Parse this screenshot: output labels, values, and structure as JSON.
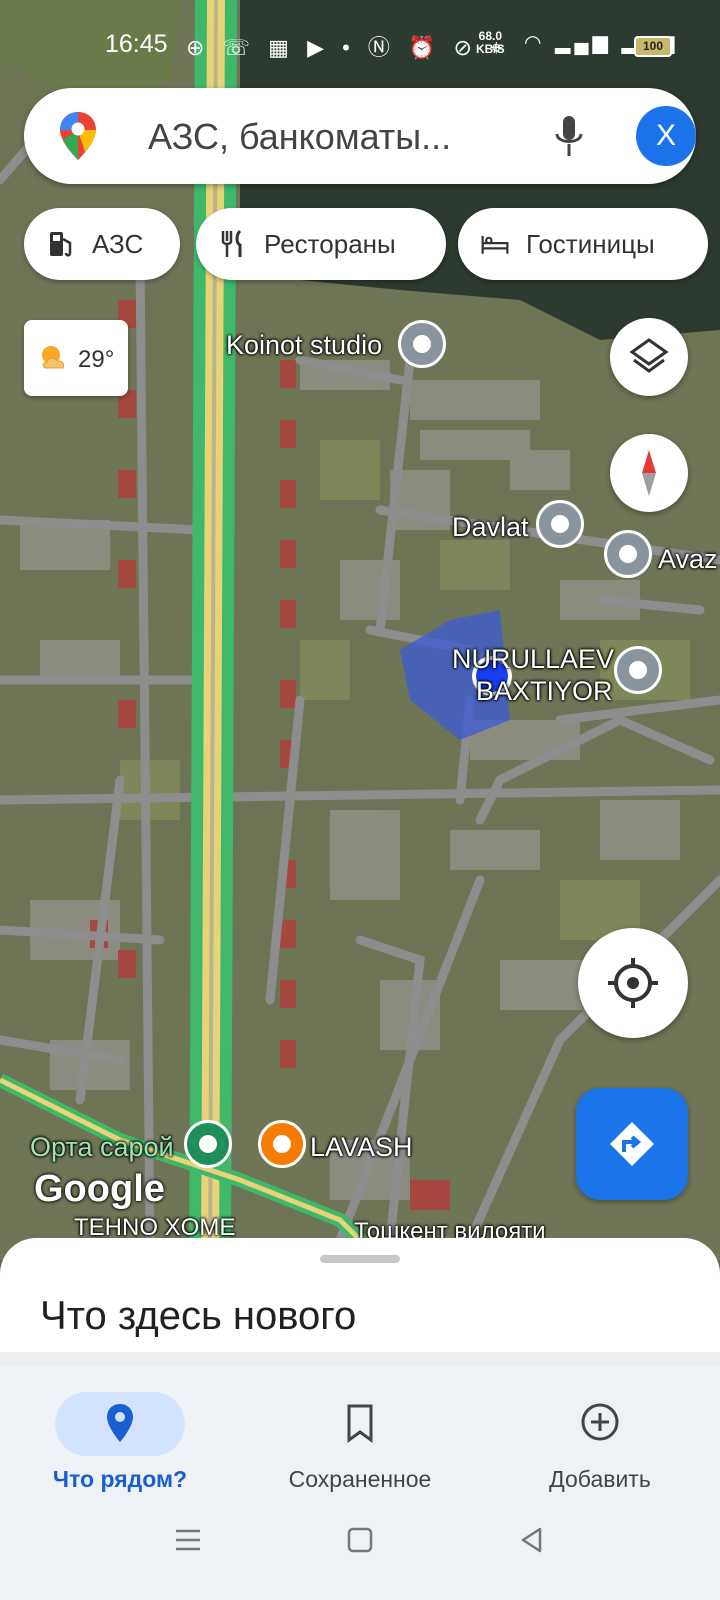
{
  "status_bar": {
    "time": "16:45",
    "speed_value": "68.0",
    "speed_unit": "KB/S",
    "battery": "100"
  },
  "search": {
    "placeholder": "АЗС, банкоматы...",
    "avatar_letter": "X"
  },
  "chips": [
    {
      "label": "АЗС",
      "icon": "gas-station-icon"
    },
    {
      "label": "Рестораны",
      "icon": "restaurant-icon"
    },
    {
      "label": "Гостиницы",
      "icon": "hotel-icon"
    }
  ],
  "weather": {
    "temp": "29°"
  },
  "map_labels": {
    "koinot": "Koinot studio",
    "davlat": "Davlat",
    "avaz": "Avaz",
    "nurullaev_1": "NURULLAEV",
    "nurullaev_2": "BAXTIYOR",
    "orta_saroy": "Орта сарой",
    "lavash": "LAVASH",
    "tehno": "TEHNO XOME",
    "toshkent": "Тошкент вилояти",
    "google": "Google"
  },
  "sheet": {
    "title": "Что здесь нового"
  },
  "bottom_nav": [
    {
      "label": "Что рядом?",
      "icon": "explore-pin-icon",
      "active": true
    },
    {
      "label": "Сохраненное",
      "icon": "bookmark-icon",
      "active": false
    },
    {
      "label": "Добавить",
      "icon": "add-circle-icon",
      "active": false
    }
  ],
  "colors": {
    "accent": "#1a73e8",
    "active_pill": "#d3e3fd",
    "road_green": "#3fb86a",
    "road_yellow": "#e8d27a"
  }
}
